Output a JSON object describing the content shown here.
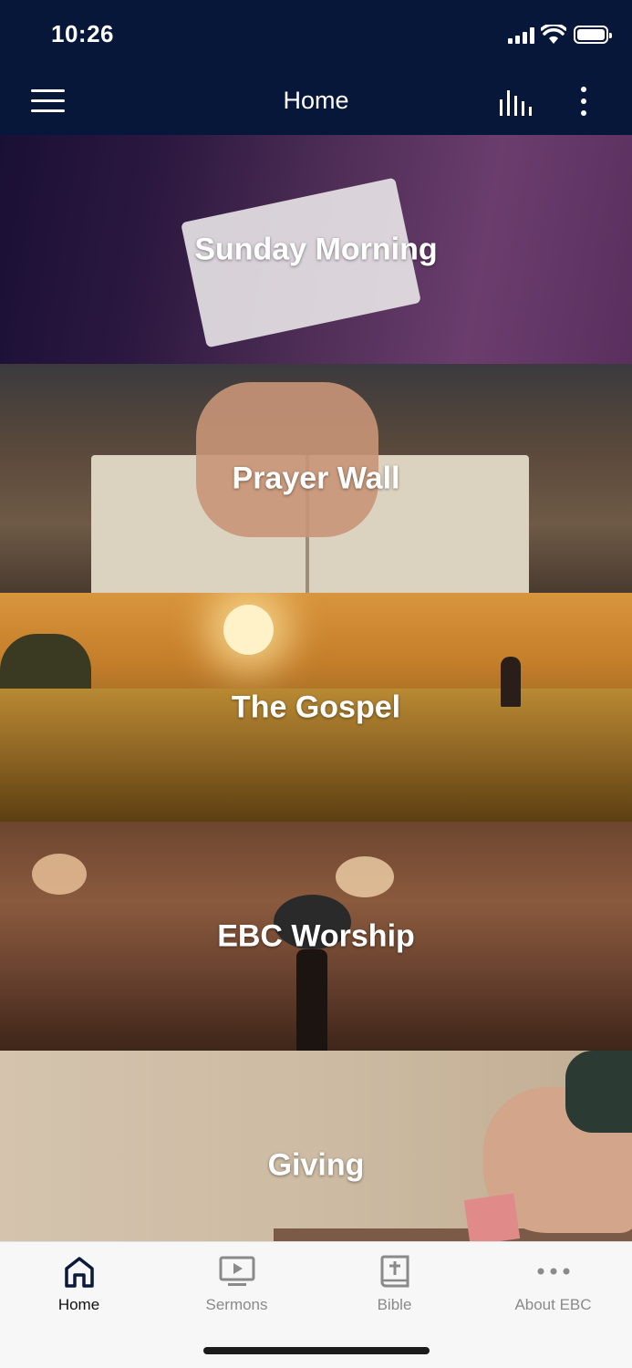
{
  "status_bar": {
    "time": "10:26"
  },
  "header": {
    "title": "Home"
  },
  "tiles": [
    {
      "label": "Sunday Morning"
    },
    {
      "label": "Prayer Wall"
    },
    {
      "label": "The Gospel"
    },
    {
      "label": "EBC Worship"
    },
    {
      "label": "Giving"
    }
  ],
  "tab_bar": {
    "items": [
      {
        "label": "Home",
        "icon": "home-icon",
        "active": true
      },
      {
        "label": "Sermons",
        "icon": "video-play-icon",
        "active": false
      },
      {
        "label": "Bible",
        "icon": "bible-icon",
        "active": false
      },
      {
        "label": "About EBC",
        "icon": "ellipsis-icon",
        "active": false
      }
    ]
  },
  "colors": {
    "header_bg": "#06173a",
    "tab_active": "#111111",
    "tab_inactive": "#8a8a8a"
  }
}
